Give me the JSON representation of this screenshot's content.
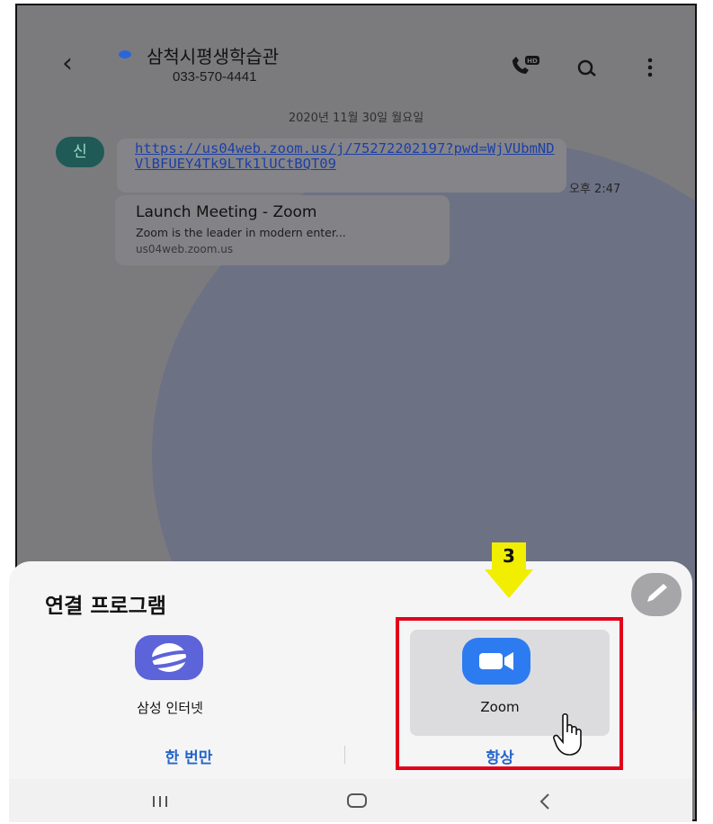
{
  "header": {
    "contact_name": "삼척시평생학습관",
    "contact_number": "033-570-4441"
  },
  "icons": {
    "back": "back-arrow-icon",
    "call": "hd-call-icon",
    "search": "search-icon",
    "more": "more-vertical-icon"
  },
  "chat": {
    "date_separator": "2020년 11월 30일 월요일",
    "avatar_text": "신",
    "message_link": "https://us04web.zoom.us/j/75272202197?pwd=WjVUbmNDVlBFUEY4Tk9LTk1lUCtBQT09",
    "message_time": "오후 2:47",
    "preview": {
      "title": "Launch Meeting - Zoom",
      "description": "Zoom is the leader in modern enter...",
      "host": "us04web.zoom.us"
    }
  },
  "sheet": {
    "title": "연결 프로그램",
    "apps": [
      {
        "label": "삼성 인터넷"
      },
      {
        "label": "Zoom"
      }
    ],
    "options": {
      "once": "한 번만",
      "always": "항상"
    }
  },
  "annotation": {
    "step": "3"
  },
  "colors": {
    "accent": "#2466c9",
    "highlight": "#e2001a",
    "step_marker": "#f1ee00",
    "zoom_brand": "#2d7bf0",
    "samsung_internet": "#5d63d8"
  }
}
